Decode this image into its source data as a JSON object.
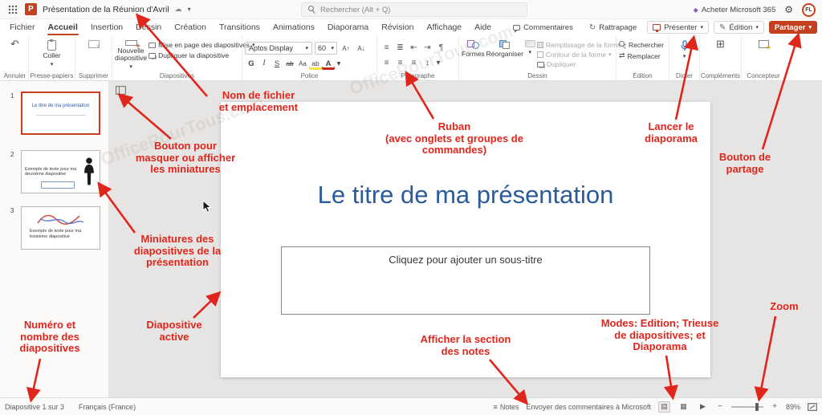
{
  "icons": {
    "dropdown": "▾",
    "cloud": "☁",
    "gear": "⚙",
    "diamond": "◆",
    "undo": "↶",
    "catchup": "↻",
    "pencil": "✎",
    "bold": "G",
    "italic": "I",
    "underline": "S",
    "strike": "ab",
    "highlight": "ab",
    "font_color": "A",
    "grow": "A↑",
    "shrink": "A↓",
    "clear": "Aa",
    "bullets": "≡",
    "numbering": "≣",
    "outdent": "⇤",
    "indent": "⇥",
    "pilcrow": "¶",
    "align_left": "≡",
    "align_center": "≡",
    "align_right": "≡",
    "align_justify": "≡",
    "spacing": "↕",
    "replace": "⇄",
    "addins": "⊞",
    "star": "★",
    "notes": "≡",
    "view_normal": "▤",
    "view_sorter": "▦",
    "view_show": "▶",
    "minus": "−",
    "plus": "+",
    "ppt": "P"
  },
  "topbar": {
    "title": "Présentation de la Réunion d'Avril",
    "search_placeholder": "Rechercher (Alt + Q)",
    "buy": "Acheter Microsoft 365",
    "avatar": "FL"
  },
  "tabs": {
    "items": [
      "Fichier",
      "Accueil",
      "Insertion",
      "Dessin",
      "Création",
      "Transitions",
      "Animations",
      "Diaporama",
      "Révision",
      "Affichage",
      "Aide"
    ],
    "comments": "Commentaires",
    "catchup": "Rattrapage",
    "present": "Présenter",
    "editing": "Édition",
    "share": "Partager"
  },
  "ribbon": {
    "undo_group": "Annuler",
    "paste": "Coller",
    "clipboard_group": "Presse-papiers",
    "delete_group": "Supprimer",
    "new_slide": "Nouvelle diapositive",
    "layout": "Mise en page des diapositives",
    "duplicate_slide": "Dupliquer la diapositive",
    "slides_group": "Diapositives",
    "font_name": "Aptos Display",
    "font_size": "60",
    "font_group": "Police",
    "paragraph_group": "Paragraphe",
    "shapes": "Formes",
    "arrange": "Réorganiser",
    "fill": "Remplissage de la forme",
    "outline": "Contour de la forme",
    "duplicate": "Dupliquer",
    "drawing_group": "Dessin",
    "find": "Rechercher",
    "replace": "Remplacer",
    "editing_group": "Édition",
    "dictate_group": "Dicter",
    "addins_group": "Compléments",
    "designer_group": "Concepteur"
  },
  "thumbnails": {
    "slides": [
      {
        "num": "1",
        "text": "Le titre de ma présentation"
      },
      {
        "num": "2",
        "text": "Exemple de texte pour ma deuxième diapositive"
      },
      {
        "num": "3",
        "text": "Exemple de texte pour ma troisième diapositive"
      }
    ]
  },
  "slide": {
    "title": "Le titre de ma présentation",
    "subtitle_placeholder": "Cliquez pour ajouter un sous-titre"
  },
  "statusbar": {
    "slide_count": "Diapositive 1 sur 3",
    "language": "Français (France)",
    "notes": "Notes",
    "feedback": "Envoyer des commentaires à Microsoft",
    "zoom": "89%"
  },
  "annotations": {
    "file_name": "Nom de fichier\net emplacement",
    "toggle_thumbs": "Bouton pour\nmasquer ou afficher\nles miniatures",
    "thumbs": "Miniatures des\ndiapositives de la\nprésentation",
    "ribbon": "Ruban\n(avec onglets et groupes de\ncommandes)",
    "present": "Lancer le\ndiaporama",
    "share": "Bouton de\npartage",
    "slide_number": "Numéro et\nnombre des\ndiapositives",
    "active_slide": "Diapositive\nactive",
    "notes": "Afficher la section\ndes notes",
    "modes": "Modes: Edition; Trieuse\nde diapositives; et\nDiaporama",
    "zoom": "Zoom"
  },
  "watermark": "OfficePourTous.com"
}
